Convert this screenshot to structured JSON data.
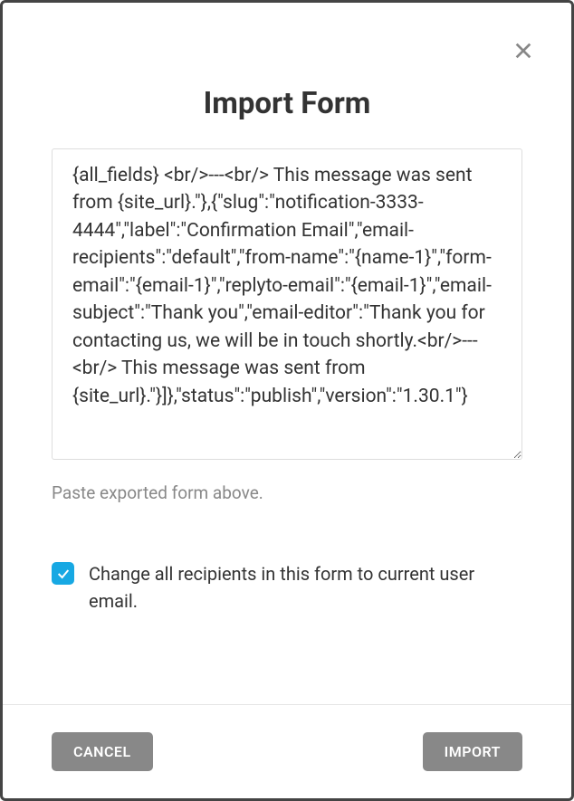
{
  "modal": {
    "title": "Import Form",
    "textarea_value": "{all_fields} <br/>---<br/> This message was sent from {site_url}.\"},{\"slug\":\"notification-3333-4444\",\"label\":\"Confirmation Email\",\"email-recipients\":\"default\",\"from-name\":\"{name-1}\",\"form-email\":\"{email-1}\",\"replyto-email\":\"{email-1}\",\"email-subject\":\"Thank you\",\"email-editor\":\"Thank you for contacting us, we will be in touch shortly.<br/>---<br/> This message was sent from {site_url}.\"}]},\"status\":\"publish\",\"version\":\"1.30.1\"}",
    "helper_text": "Paste exported form above.",
    "checkbox_label": "Change all recipients in this form to current user email.",
    "buttons": {
      "cancel": "CANCEL",
      "import": "IMPORT"
    }
  }
}
